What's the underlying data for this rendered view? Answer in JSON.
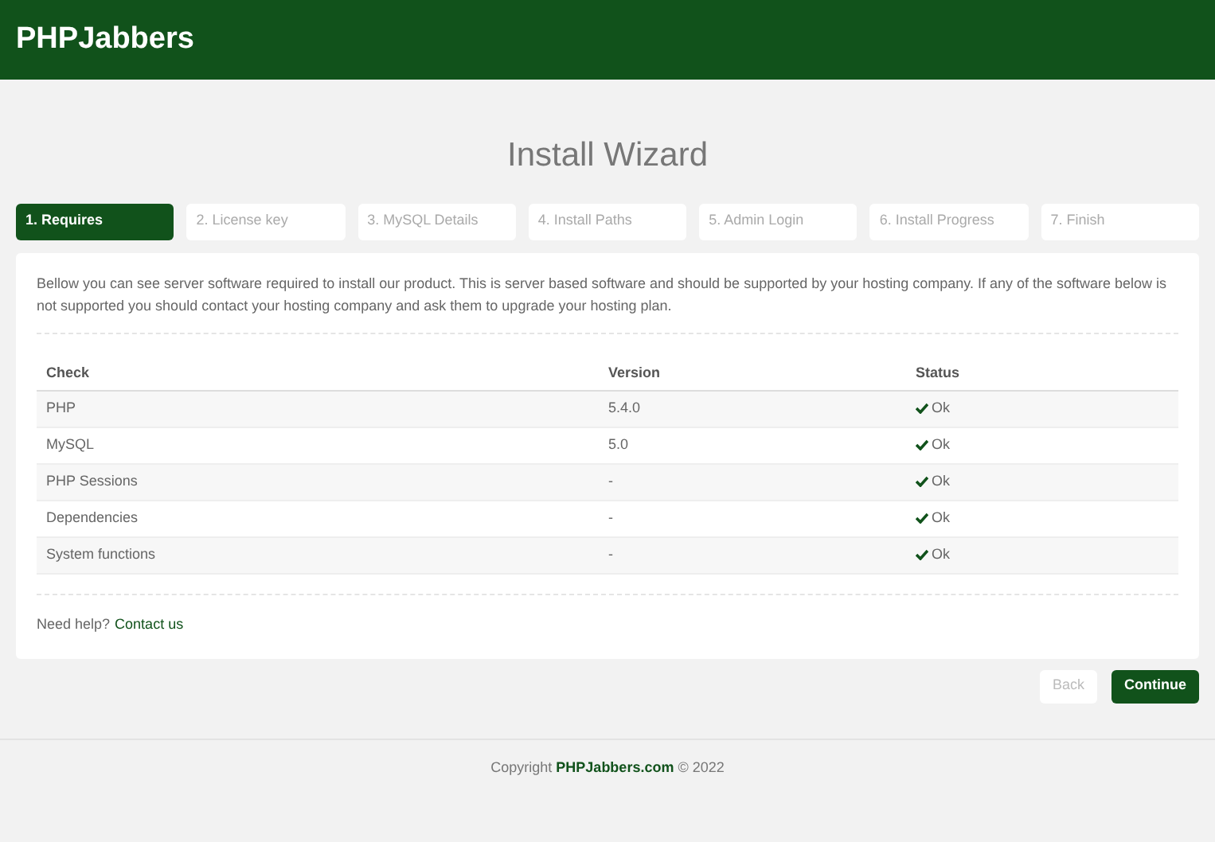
{
  "header": {
    "logo": "PHPJabbers"
  },
  "title": "Install Wizard",
  "steps": [
    {
      "label": "1. Requires",
      "selected": true
    },
    {
      "label": "2. License key",
      "selected": false
    },
    {
      "label": "3. MySQL Details",
      "selected": false
    },
    {
      "label": "4. Install Paths",
      "selected": false
    },
    {
      "label": "5. Admin Login",
      "selected": false
    },
    {
      "label": "6. Install Progress",
      "selected": false
    },
    {
      "label": "7. Finish",
      "selected": false
    }
  ],
  "intro": "Bellow you can see server software required to install our product. This is server based software and should be supported by your hosting company. If any of the software below is not supported you should contact your hosting company and ask them to upgrade your hosting plan.",
  "table": {
    "columns": [
      "Check",
      "Version",
      "Status"
    ],
    "rows": [
      [
        "PHP",
        "5.4.0",
        "Ok"
      ],
      [
        "MySQL",
        "5.0",
        "Ok"
      ],
      [
        "PHP Sessions",
        "-",
        "Ok"
      ],
      [
        "Dependencies",
        "-",
        "Ok"
      ],
      [
        "System functions",
        "-",
        "Ok"
      ]
    ]
  },
  "help": {
    "text": "Need help?",
    "link": "Contact us"
  },
  "buttons": [
    {
      "label": "Back",
      "disabled": true
    },
    {
      "label": "Continue",
      "disabled": false
    }
  ],
  "footer": "Copyright **PHPJabbers.com** © 2022"
}
